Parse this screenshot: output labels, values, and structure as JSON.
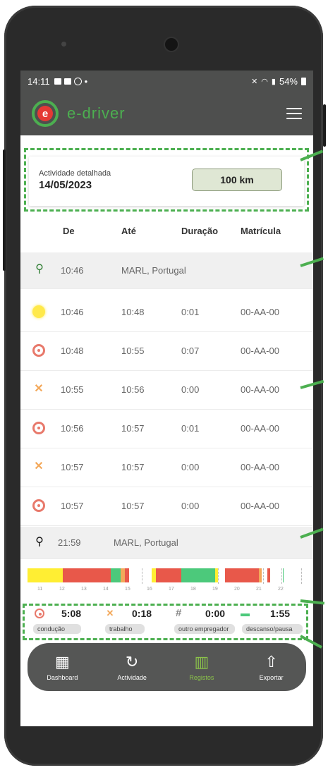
{
  "status_bar": {
    "time": "14:11",
    "battery": "54%"
  },
  "app": {
    "brand": "e-driver"
  },
  "activity_card": {
    "label": "Actividade detalhada",
    "date": "14/05/2023",
    "distance": "100 km"
  },
  "table": {
    "headers": [
      "De",
      "Até",
      "Duração",
      "Matrícula"
    ],
    "start_location": {
      "time": "10:46",
      "place": "MARL, Portugal"
    },
    "rows": [
      {
        "icon": "sun-icon",
        "from": "10:46",
        "to": "10:48",
        "duration": "0:01",
        "plate": "00-AA-00"
      },
      {
        "icon": "steering-wheel-icon",
        "from": "10:48",
        "to": "10:55",
        "duration": "0:07",
        "plate": "00-AA-00"
      },
      {
        "icon": "tools-icon",
        "from": "10:55",
        "to": "10:56",
        "duration": "0:00",
        "plate": "00-AA-00"
      },
      {
        "icon": "steering-wheel-icon",
        "from": "10:56",
        "to": "10:57",
        "duration": "0:01",
        "plate": "00-AA-00"
      },
      {
        "icon": "tools-icon",
        "from": "10:57",
        "to": "10:57",
        "duration": "0:00",
        "plate": "00-AA-00"
      },
      {
        "icon": "steering-wheel-icon",
        "from": "10:57",
        "to": "10:57",
        "duration": "0:00",
        "plate": "00-AA-00"
      }
    ],
    "end_location": {
      "time": "21:59",
      "place": "MARL, Portugal"
    }
  },
  "timeline": {
    "hours": [
      "11",
      "12",
      "13",
      "14",
      "15",
      "16",
      "17",
      "18",
      "19",
      "20",
      "21",
      "22"
    ],
    "colors": {
      "driving": "#e8584a",
      "work": "#f3a85a",
      "rest": "#4cc97b",
      "availability": "#ffee33"
    }
  },
  "summary": {
    "driving": {
      "value": "5:08",
      "label": "condução"
    },
    "work": {
      "value": "0:18",
      "label": "trabalho"
    },
    "other": {
      "value": "0:00",
      "label": "outro empregador"
    },
    "rest": {
      "value": "1:55",
      "label": "descanso/pausa"
    }
  },
  "nav": {
    "items": [
      "Dashboard",
      "Actividade",
      "Registos",
      "Exportar"
    ],
    "active": "Registos"
  }
}
